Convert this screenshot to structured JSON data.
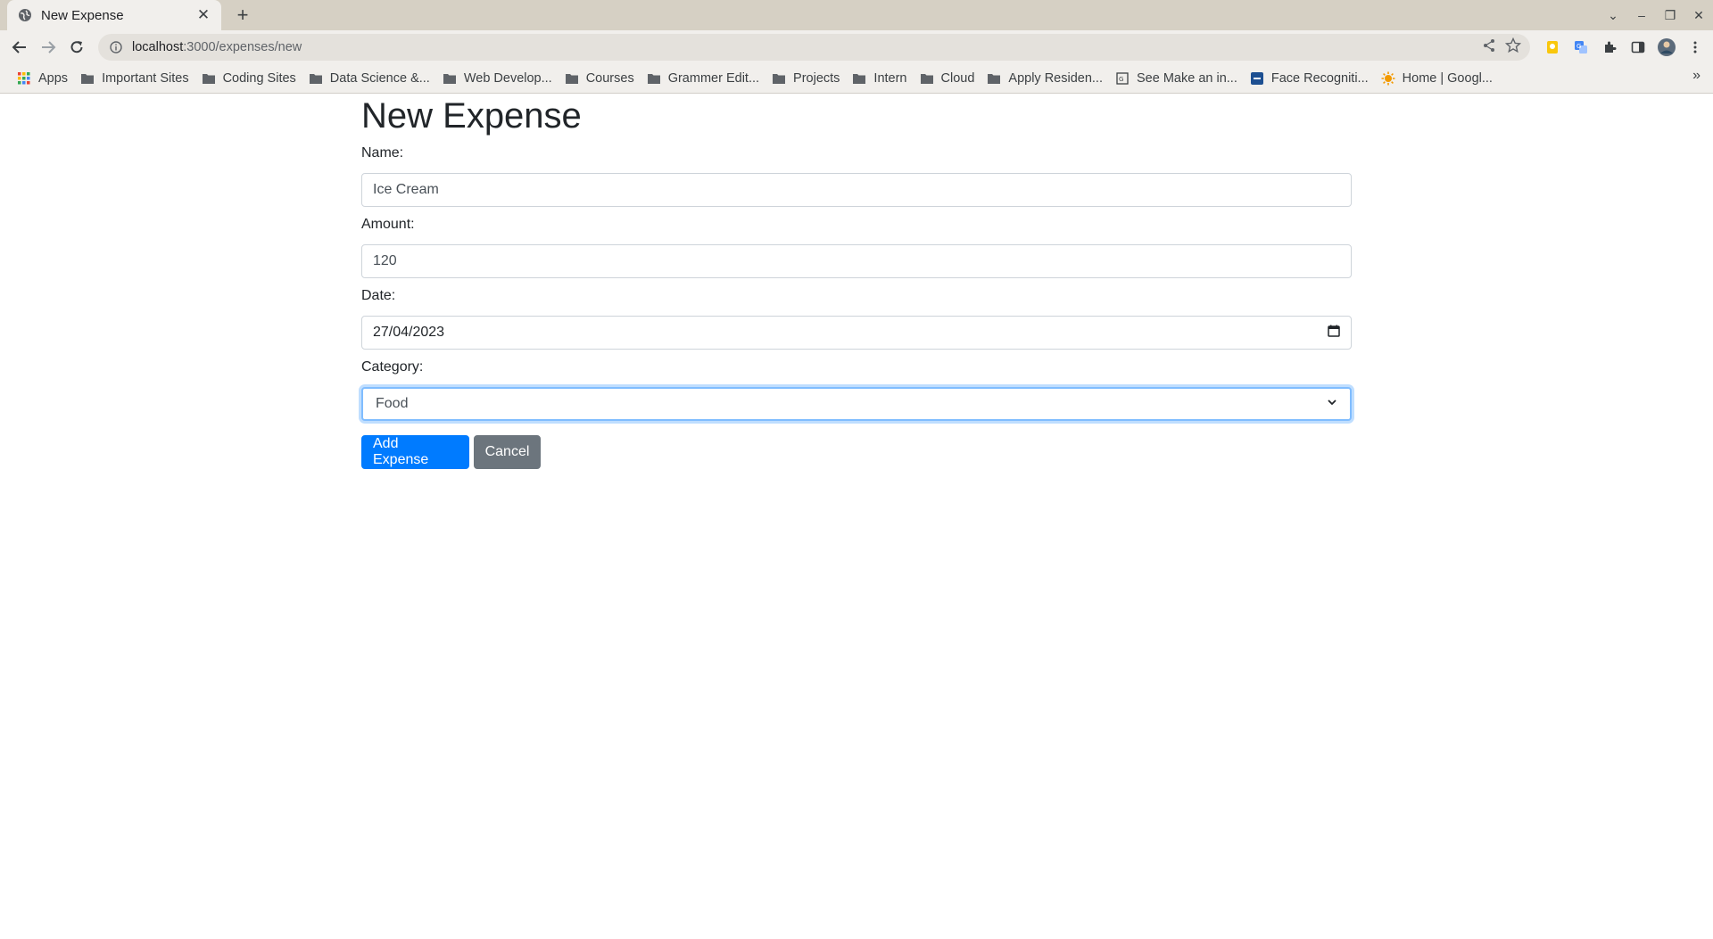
{
  "browser": {
    "tab_title": "New Expense",
    "tab_close": "✕",
    "new_tab": "+",
    "url_host": "localhost",
    "url_path": ":3000/expenses/new",
    "window_controls": {
      "dropdown": "⌄",
      "minimize": "–",
      "restore": "❐",
      "close": "✕"
    }
  },
  "bookmarks": [
    {
      "label": "Apps",
      "icon": "apps-grid-icon"
    },
    {
      "label": "Important Sites",
      "icon": "folder-icon"
    },
    {
      "label": "Coding Sites",
      "icon": "folder-icon"
    },
    {
      "label": "Data Science &...",
      "icon": "folder-icon"
    },
    {
      "label": "Web Develop...",
      "icon": "folder-icon"
    },
    {
      "label": "Courses",
      "icon": "folder-icon"
    },
    {
      "label": "Grammer Edit...",
      "icon": "folder-icon"
    },
    {
      "label": "Projects",
      "icon": "folder-icon"
    },
    {
      "label": "Intern",
      "icon": "folder-icon"
    },
    {
      "label": "Cloud",
      "icon": "folder-icon"
    },
    {
      "label": "Apply Residen...",
      "icon": "folder-icon"
    },
    {
      "label": "See Make an in...",
      "icon": "page-icon"
    },
    {
      "label": "Face Recogniti...",
      "icon": "site-icon"
    },
    {
      "label": "Home | Googl...",
      "icon": "sun-icon"
    }
  ],
  "bookmarks_more": "»",
  "form": {
    "title": "New Expense",
    "name_label": "Name:",
    "name_value": "Ice Cream",
    "amount_label": "Amount:",
    "amount_value": "120",
    "date_label": "Date:",
    "date_value": "27/04/2023",
    "category_label": "Category:",
    "category_value": "Food",
    "submit_label": "Add Expense",
    "cancel_label": "Cancel"
  },
  "colors": {
    "primary": "#007bff",
    "secondary": "#6c757d",
    "focus_border": "#80bdff"
  }
}
